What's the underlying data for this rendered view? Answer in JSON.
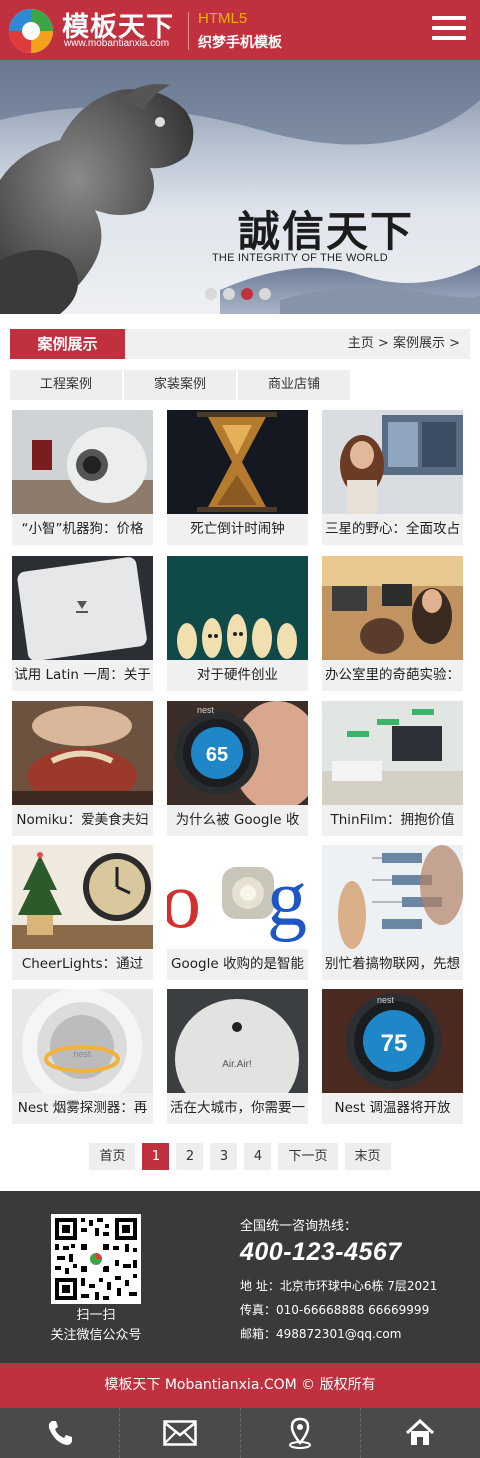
{
  "header": {
    "logo_title": "模板天下",
    "logo_url": "www.mobantianxia.com",
    "logo_html5": "HTML5",
    "logo_sub": "织梦手机模板"
  },
  "banner": {
    "title": "誠信天下",
    "tagline": "THE INTEGRITY OF THE WORLD",
    "slides_count": 4,
    "active_slide": 3
  },
  "section": {
    "title": "案例展示",
    "breadcrumb": [
      "主页",
      ">",
      "案例展示",
      ">"
    ]
  },
  "subtabs": [
    "工程案例",
    "家装案例",
    "商业店铺"
  ],
  "cases": [
    {
      "caption": "“小智”机器狗：价格",
      "theme": "robot"
    },
    {
      "caption": "死亡倒计时闹钟",
      "theme": "hourglass"
    },
    {
      "caption": "三星的野心：全面攻占",
      "theme": "samsung"
    },
    {
      "caption": "试用 Latin 一周：关于",
      "theme": "scale"
    },
    {
      "caption": "对于硬件创业",
      "theme": "fingers"
    },
    {
      "caption": "办公室里的奇葩实验：",
      "theme": "office"
    },
    {
      "caption": "Nomiku：爱美食夫妇",
      "theme": "nomiku"
    },
    {
      "caption": "为什么被 Google 收",
      "theme": "nest65"
    },
    {
      "caption": "ThinFilm：拥抱价值",
      "theme": "room"
    },
    {
      "caption": "CheerLights：通过",
      "theme": "clock"
    },
    {
      "caption": "Google 收购的是智能",
      "theme": "google"
    },
    {
      "caption": "别忙着搞物联网，先想",
      "theme": "diagram"
    },
    {
      "caption": "Nest 烟雾探测器：再",
      "theme": "smoke"
    },
    {
      "caption": "活在大城市，你需要一",
      "theme": "airair"
    },
    {
      "caption": "Nest 调温器将开放",
      "theme": "nest75"
    }
  ],
  "pagination": {
    "first": "首页",
    "pages": [
      "1",
      "2",
      "3",
      "4"
    ],
    "current": "1",
    "next": "下一页",
    "last": "末页"
  },
  "footer": {
    "qr_caption1": "扫一扫",
    "qr_caption2": "关注微信公众号",
    "hotline_label": "全国统一咨询热线：",
    "phone": "400-123-4567",
    "address": "地 址：北京市环球中心6栋 7层2021",
    "fax": "传真：010-66668888 66669999",
    "email": "邮箱：498872301@qq.com",
    "copyright": "模板天下 Mobantianxia.COM © 版权所有"
  },
  "bottom_nav": [
    "phone-icon",
    "mail-icon",
    "location-icon",
    "home-icon"
  ],
  "colors": {
    "brand": "#c1303e",
    "footer_bg": "#3a3a3a",
    "accent_html5": "#f0b000"
  }
}
